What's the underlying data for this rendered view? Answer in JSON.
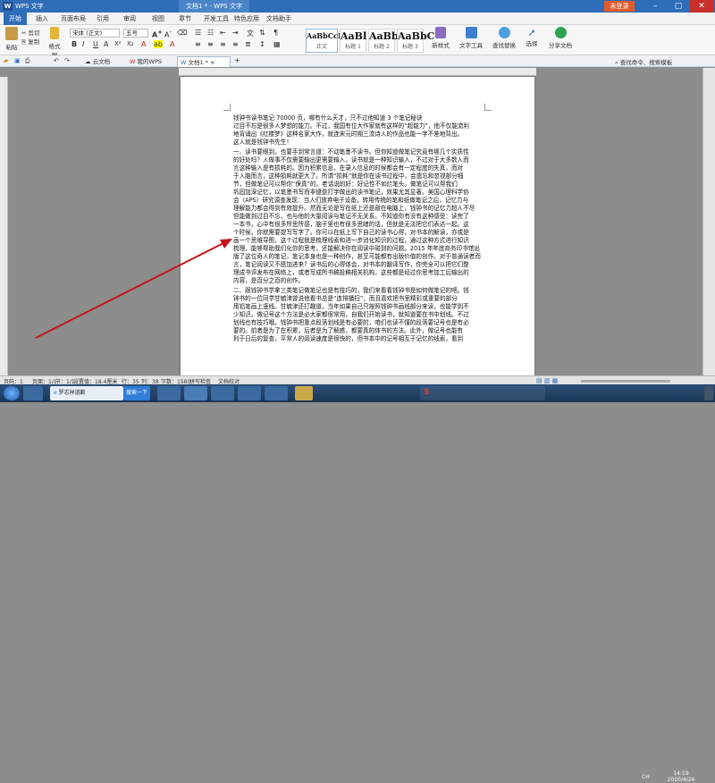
{
  "window": {
    "app_name": "WPS 文字",
    "doc_tab": "文档1 * - WPS 文字",
    "login_label": "未登录"
  },
  "menu": {
    "items": [
      "开始",
      "插入",
      "页面布局",
      "引用",
      "审阅",
      "视图",
      "章节",
      "开发工具",
      "特色应用",
      "文档助手"
    ]
  },
  "ribbon": {
    "paste": "粘贴",
    "cut": "剪切",
    "copy": "复制",
    "format_painter": "格式刷",
    "font_name": "宋体 (正文)",
    "font_size": "五号",
    "styles": [
      {
        "preview": "AaBbCcDd",
        "name": "正文"
      },
      {
        "preview": "AaBl",
        "name": "标题 1"
      },
      {
        "preview": "AaBbC",
        "name": "标题 2"
      },
      {
        "preview": "AaBbC",
        "name": "标题 3"
      }
    ],
    "new_style": "新样式",
    "text_tools": "文字工具",
    "find_replace": "查找替换",
    "select": "选择",
    "share": "分享文档"
  },
  "tabs": [
    {
      "label": "云文档"
    },
    {
      "label": "我的WPS"
    },
    {
      "label": "文档1 *"
    }
  ],
  "search_hint": "查找命令、搜索模板",
  "document": {
    "lines": [
      "钱钟书读书笔记 70000 页，哪有什么天才，只不过他知道 3 个笔记秘诀",
      "过目不忘是很多人梦想的能力。不过，我国有位大作家就有这样的“超能力”，他不仅能流利",
      "地背诵出《红楼梦》这种名家大作，就连宋元时期三流诗人的作品也能一字不差地背出。",
      "这人就是钱钟书先生！",
      "一、读书要眼到，也要手到常言道：不动笔墨不读书。但你知道做笔记究竟有哪几个实质性",
      "的好处吗？人做事不仅需要输出更需要输入，读书就是一种知识输入，不过对于大多数人而",
      "言这种输入是有损耗的。因为积累信息，在录入信息的时候都会有一定程度的失真，而对",
      "于人脑而言，这种损耗就更大了。所谓“损耗”就是你在读书过程中，会遗忘和忽视部分细",
      "节，但做笔记可以帮你“保真”的。老话说的好：好记性不如烂笔头。做笔记可以帮我们",
      "巩固加深记忆，以笔墨书写而非键盘打字做出的读书笔记，效果尤其显著。美国心理科学协",
      "会（APS）研究调查发现：当人们放弃电子设备，转用传统的笔和纸做笔记之后，记忆力与",
      "理解能力都会得到有效提升。然而无论是写在纸上还是敲在电脑上，钱钟书的记忆力超人不尽",
      "但能做到过目不忘，也与他的大量阅读与笔记不无关系。不知道你有没有这种感受：读完了",
      "一本书，心中有很多所思所感，脑子里也有很多思绪的话，但就是无法把它们表达一起。这",
      "个时候，你就需要提写写字了。你可以在纸上写下自己的读书心得，对书本的解读，亦或是",
      "画一个思维导图，这个过程就是梳理线索和进一步消化知识的过程，通过这种方式进行知识",
      "梳理，能够帮助我们化你的思考，还能解决你在阅读中碰到的问题。2015 年年底商务印书馆出",
      "版了这位奇人的笔记，笔记本身也是一种创作，甚至可能都有出版价值的创作。对于普通读者而",
      "言，笔记阅读又不愿加进来？读书后的心得体会，对书本的翻译写作，你完全可以把它们整",
      "理成书评发布在网络上，或者写成所书稿投稿相关机构，这些都是经过你思考加工后输出的",
      "内容，是百分之百的创作。",
      "二、跟钱钟书学拿三类笔记做笔记也是有技巧的，我们来看看钱钟书是如何做笔记的吧。钱",
      "钟书的一位同学甘毓津曾说他看书总是“连排播扫”，而且喜欢把书里精彩或重要的部分",
      "用铅笔画上竖线。甘毓津还打趣道，当年如果自己只按照钱钟书画线部分来读，也能学到不",
      "少知识。做记号这个方法是必大家都很常用，自我们开始读书，就知道要在书中划线。不过",
      "划线也有技巧哦。钱钟书把重点段落划线是有必要的，咱们也读不懂的段落要记号也是有必",
      "要的。前者是为了在积累，后者是为了解惑，都要真的体书的方法。此外，做记号也能有",
      "利于日后的复查，平常人的阅读速度是很快的，但书本中的记号相互于记忆的线索，看到"
    ]
  },
  "status": {
    "page": "页码：1",
    "pages": "页面：1/1",
    "section": "节：1/1",
    "position": "设置值：18.4厘米",
    "row": "行：35",
    "col": "列：38",
    "words": "字数：1580",
    "spell": "拼写检查",
    "doc_check": "文档校对"
  },
  "taskbar": {
    "clock_time": "14:19",
    "clock_date": "2020/4/24",
    "ie_label": "罗志祥道歉",
    "search_btn": "搜索一下",
    "lang": "CH"
  }
}
